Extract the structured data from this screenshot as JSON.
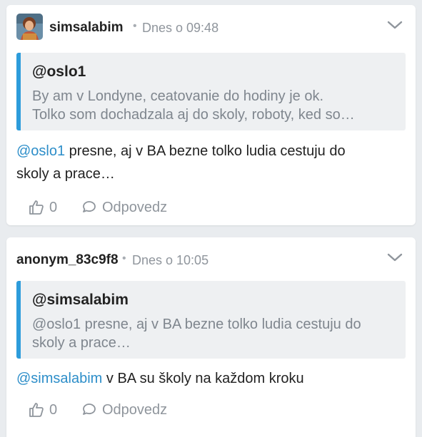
{
  "comments": [
    {
      "author": "simsalabim",
      "separator": "•",
      "time": "Dnes o 09:48",
      "quote": {
        "author": "@oslo1",
        "text_line1": "By am v Londyne, ceatovanie do hodiny je ok.",
        "text_line2": "Tolko som dochadzala aj do skoly, roboty, ked so…"
      },
      "mention": "@oslo1",
      "body_line1": " presne, aj v BA bezne tolko ludia cestuju do",
      "body_line2": "skoly a prace…",
      "likes": "0",
      "reply_label": "Odpovedz"
    },
    {
      "author": "anonym_83c9f8",
      "separator": "•",
      "time": "Dnes o 10:05",
      "quote": {
        "author": "@simsalabim",
        "text_line1": "@oslo1 presne, aj v BA bezne tolko ludia cestuju do",
        "text_line2": "skoly a prace…"
      },
      "mention": "@simsalabim",
      "body_line1": " v BA su školy na každom kroku",
      "likes": "0",
      "reply_label": "Odpovedz"
    }
  ],
  "colors": {
    "accent": "#2d9cdb",
    "mention": "#2d8ec9",
    "muted": "#8f959c",
    "page_bg": "#e9ecef",
    "quote_bg": "#eef0f2"
  },
  "icons": {
    "avatar": "avatar-illustration",
    "menu": "chevron-down-icon",
    "like": "thumbs-up-icon",
    "reply": "speech-bubble-icon"
  }
}
